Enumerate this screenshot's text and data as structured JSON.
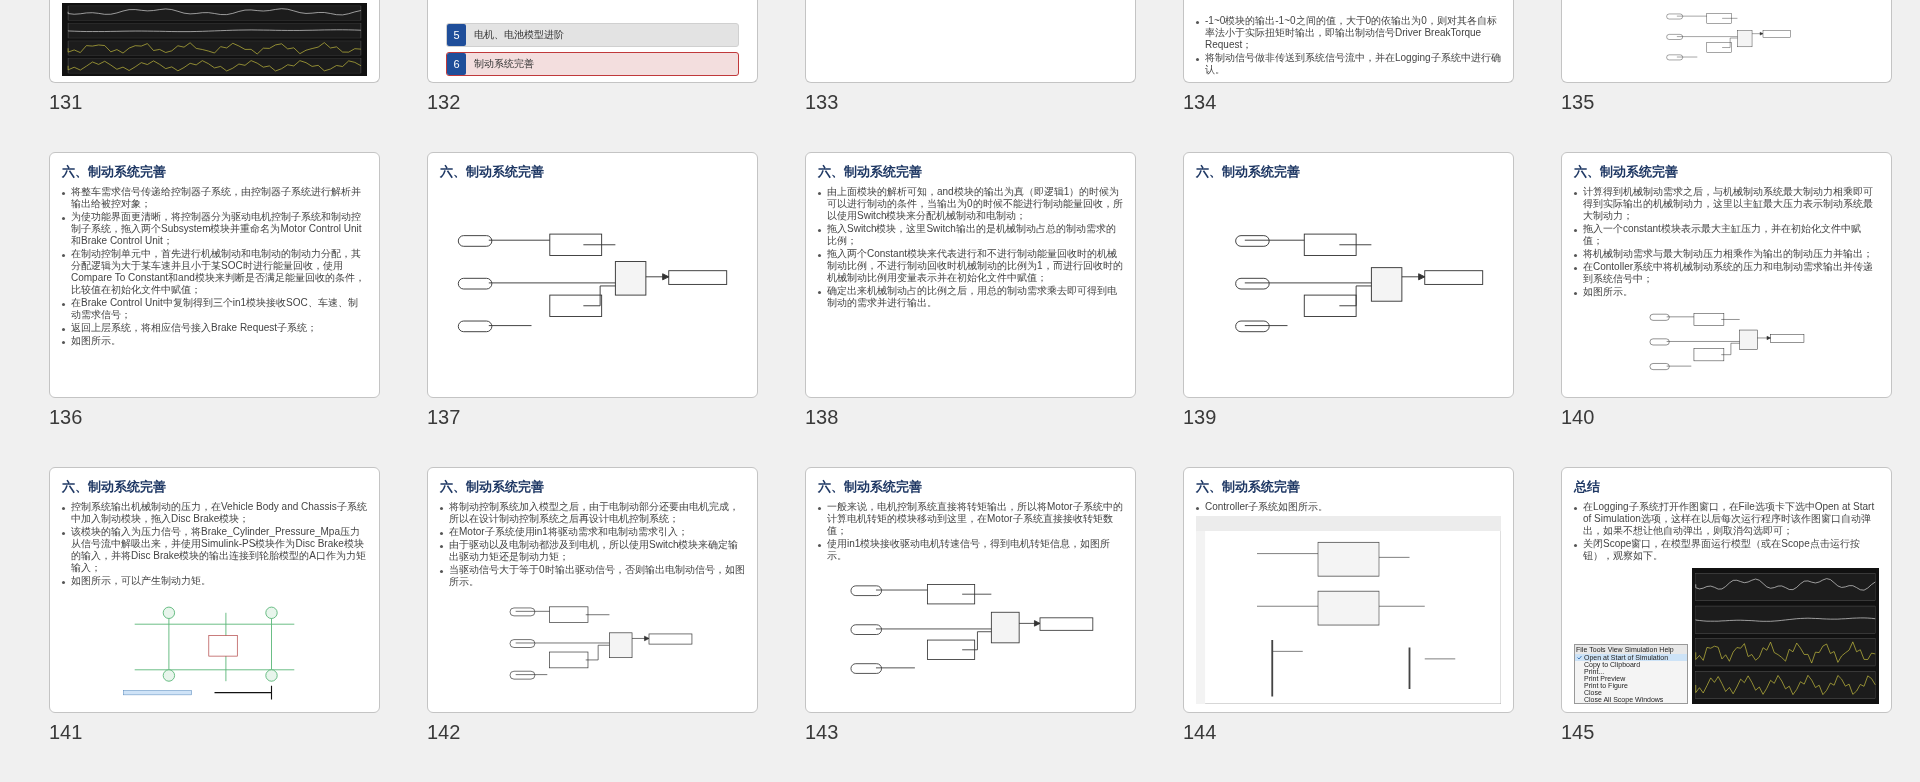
{
  "rows": [
    {
      "cut_top": true,
      "slides": [
        {
          "number": "131",
          "kind": "figure",
          "figure": {
            "kind": "scope"
          }
        },
        {
          "number": "132",
          "kind": "agenda",
          "items": [
            {
              "number": "5",
              "label": "电机、电池模型进阶",
              "selected": false
            },
            {
              "number": "6",
              "label": "制动系统完善",
              "selected": true
            }
          ]
        },
        {
          "number": "133",
          "kind": "blank"
        },
        {
          "number": "134",
          "kind": "content",
          "bullets": [
            "-1~0模块的输出-1~0之间的值，大于0的依输出为0，则对其各自标率法小于实际扭矩时输出，即输出制动信号Driver BreakTorque Request；",
            "将制动信号做非传送到系统信号流中，并在Logging子系统中进行确认。"
          ]
        },
        {
          "number": "135",
          "kind": "figure",
          "figure": {
            "kind": "diagram"
          }
        }
      ]
    },
    {
      "cut_top": false,
      "slides": [
        {
          "number": "136",
          "kind": "content",
          "title": "六、制动系统完善",
          "bullets": [
            "将整车需求信号传递给控制器子系统，由控制器子系统进行解析并输出给被控对象；",
            "为使功能界面更清晰，将控制器分为驱动电机控制子系统和制动控制子系统，拖入两个Subsystem模块并重命名为Motor Control Unit和Brake Control Unit；",
            "在制动控制单元中，首先进行机械制动和电制动的制动力分配，其分配逻辑为大于某车速并且小于某SOC时进行能量回收，使用Compare To Constant和and模块来判断是否满足能量回收的条件，比较值在初始化文件中赋值；",
            "在Brake Control Unit中复制得到三个in1模块接收SOC、车速、制动需求信号；",
            "返回上层系统，将相应信号接入Brake Request子系统；",
            "如图所示。"
          ]
        },
        {
          "number": "137",
          "kind": "content",
          "title": "六、制动系统完善",
          "figure": {
            "kind": "diagram"
          }
        },
        {
          "number": "138",
          "kind": "content",
          "title": "六、制动系统完善",
          "bullets": [
            "由上面模块的解析可知，and模块的输出为真（即逻辑1）的时候为可以进行制动的条件，当输出为0的时候不能进行制动能量回收，所以使用Switch模块来分配机械制动和电制动；",
            "拖入Switch模块，这里Switch输出的是机械制动占总的制动需求的比例；",
            "拖入两个Constant模块来代表进行和不进行制动能量回收时的机械制动比例，不进行制动回收时机械制动的比例为1，而进行回收时的机械制动比例用变量表示并在初始化文件中赋值；",
            "确定出来机械制动占的比例之后，用总的制动需求乘去即可得到电制动的需求并进行输出。"
          ]
        },
        {
          "number": "139",
          "kind": "content",
          "title": "六、制动系统完善",
          "figure": {
            "kind": "diagram"
          }
        },
        {
          "number": "140",
          "kind": "content",
          "title": "六、制动系统完善",
          "bullets": [
            "计算得到机械制动需求之后，与机械制动系统最大制动力相乘即可得到实际输出的机械制动力，这里以主缸最大压力表示制动系统最大制动力；",
            "拖入一个constant模块表示最大主缸压力，并在初始化文件中赋值；",
            "将机械制动需求与最大制动压力相乘作为输出的制动压力并输出；",
            "在Contoller系统中将机械制动系统的压力和电制动需求输出并传递到系统信号中；",
            "如图所示。"
          ],
          "figure": {
            "kind": "diagram"
          }
        }
      ]
    },
    {
      "cut_top": false,
      "slides": [
        {
          "number": "141",
          "kind": "content",
          "title": "六、制动系统完善",
          "bullets": [
            "控制系统输出机械制动的压力，在Vehicle Body and Chassis子系统中加入制动模块，拖入Disc Brake模块；",
            "该模块的输入为压力信号，将Brake_Cylinder_Pressure_Mpa压力从信号流中解吸出来，并使用Simulink-PS模块作为Disc Brake模块的输入，并将Disc Brake模块的输出连接到轮胎模型的A口作为力矩输入；",
            "如图所示，可以产生制动力矩。"
          ],
          "figure": {
            "kind": "simscape"
          }
        },
        {
          "number": "142",
          "kind": "content",
          "title": "六、制动系统完善",
          "bullets": [
            "将制动控制系统加入模型之后，由于电制动部分还要由电机完成，所以在设计制动控制系统之后再设计电机控制系统；",
            "在Motor子系统使用in1将驱动需求和电制动需求引入；",
            "由于驱动以及电制动都涉及到电机，所以使用Switch模块来确定输出驱动力矩还是制动力矩；",
            "当驱动信号大于等于0时输出驱动信号，否则输出电制动信号，如图所示。"
          ],
          "figure": {
            "kind": "diagram"
          }
        },
        {
          "number": "143",
          "kind": "content",
          "title": "六、制动系统完善",
          "bullets": [
            "一般来说，电机控制系统直接将转矩输出，所以将Motor子系统中的计算电机转矩的模块移动到这里，在Motor子系统直接接收转矩数值；",
            "使用in1模块接收驱动电机转速信号，得到电机转矩信息，如图所示。"
          ],
          "figure": {
            "kind": "diagram"
          }
        },
        {
          "number": "144",
          "kind": "content",
          "title": "六、制动系统完善",
          "bullets": [
            "Controller子系统如图所示。"
          ],
          "figure": {
            "kind": "window"
          }
        },
        {
          "number": "145",
          "kind": "content",
          "title": "总结",
          "bullets": [
            "在Logging子系统打开作图窗口，在File选项卡下选中Open at Start of Simulation选项，这样在以后每次运行程序时该作图窗口自动弹出，如果不想让他自动弹出，则取消勾选即可；",
            "关闭Scope窗口，在模型界面运行模型（或在Scope点击运行按钮），观察如下。"
          ],
          "figure": {
            "kind": "scope"
          },
          "menu": {
            "bar": [
              "File",
              "Tools",
              "View",
              "Simulation",
              "Help"
            ],
            "items": [
              {
                "label": "Open at Start of Simulation",
                "checked": true
              },
              {
                "label": "Copy to Clipboard",
                "checked": false
              },
              {
                "label": "Print...",
                "checked": false
              },
              {
                "label": "Print Preview",
                "checked": false
              },
              {
                "label": "Print to Figure",
                "checked": false
              },
              {
                "label": "Close",
                "checked": false
              },
              {
                "label": "Close All Scope Windows",
                "checked": false
              }
            ]
          }
        }
      ]
    }
  ]
}
